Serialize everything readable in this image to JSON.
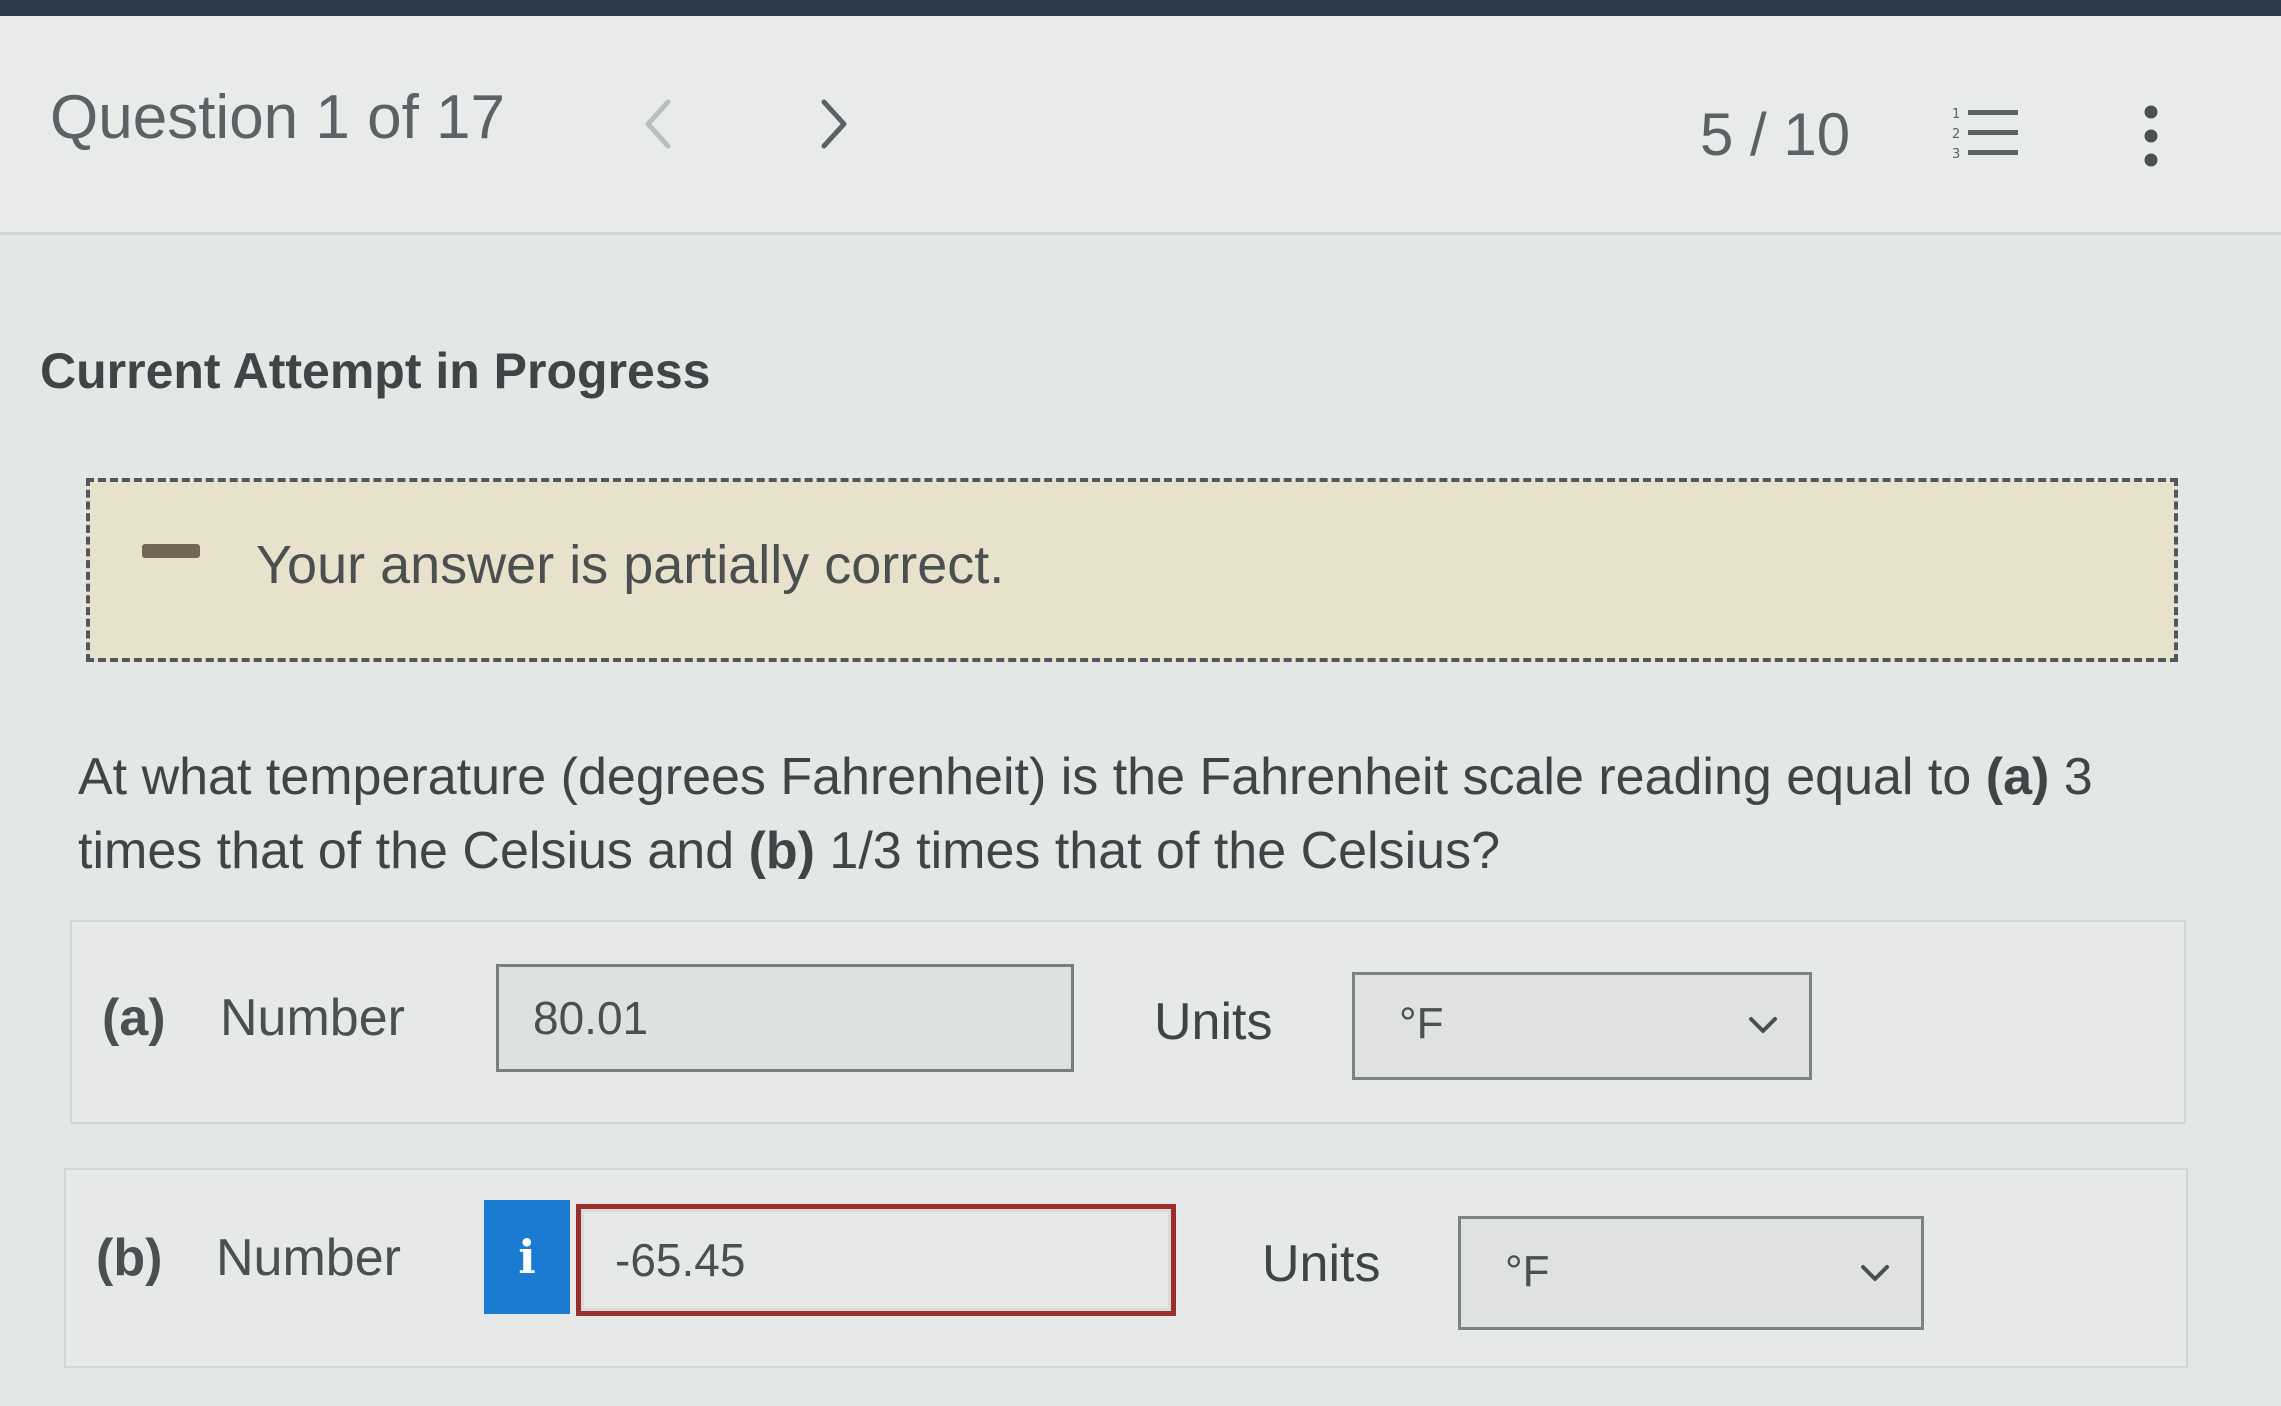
{
  "header": {
    "question_label": "Question 1 of 17",
    "score": "5 / 10",
    "icons": {
      "prev": "chevron-left-icon",
      "next": "chevron-right-icon",
      "list": "numbered-list-icon",
      "more": "vertical-ellipsis-icon"
    }
  },
  "status": {
    "heading": "Current Attempt in Progress"
  },
  "feedback": {
    "message": "Your answer is partially correct.",
    "icon": "partial-correct-dash-icon"
  },
  "question": {
    "prefix": "At what temperature (degrees Fahrenheit) is the Fahrenheit scale reading equal to ",
    "part_a_marker": "(a)",
    "middle": " 3 times that of the Celsius and ",
    "part_b_marker": "(b)",
    "suffix": " 1/3 times that of the Celsius?"
  },
  "answers": [
    {
      "part_label": "(a)",
      "number_label": "Number",
      "value": "80.01",
      "units_label": "Units",
      "unit_value": "°F",
      "status": "correct"
    },
    {
      "part_label": "(b)",
      "number_label": "Number",
      "value": "-65.45",
      "units_label": "Units",
      "unit_value": "°F",
      "status": "incorrect",
      "info_icon_glyph": "i"
    }
  ],
  "colors": {
    "feedback_bg": "#e8e2cc",
    "incorrect_border": "#9a2e2e",
    "info_badge": "#1a7bd0"
  }
}
